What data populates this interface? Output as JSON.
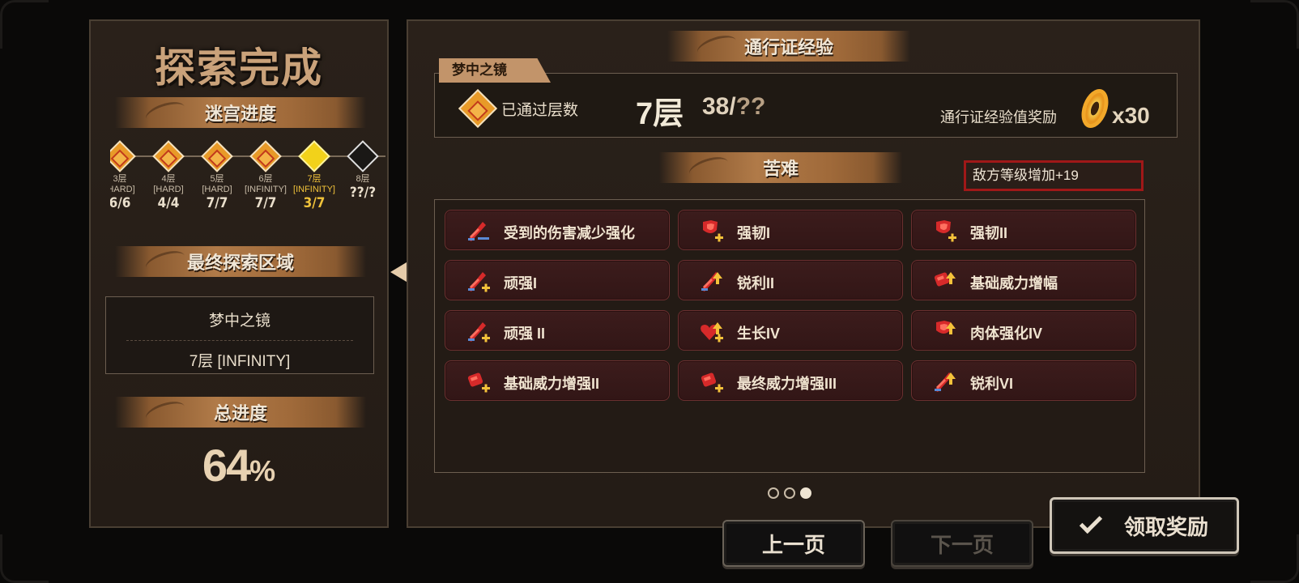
{
  "left": {
    "title": "探索完成",
    "maze_header": "迷宫进度",
    "floors": [
      {
        "name": "3层",
        "difficulty": "[HARD]",
        "progress": "6/6",
        "state": "done"
      },
      {
        "name": "4层",
        "difficulty": "[HARD]",
        "progress": "4/4",
        "state": "done"
      },
      {
        "name": "5层",
        "difficulty": "[HARD]",
        "progress": "7/7",
        "state": "done"
      },
      {
        "name": "6层",
        "difficulty": "[INFINITY]",
        "progress": "7/7",
        "state": "done"
      },
      {
        "name": "7层",
        "difficulty": "[INFINITY]",
        "progress": "3/7",
        "state": "current"
      },
      {
        "name": "8层",
        "difficulty": "",
        "progress": "??/?",
        "state": "locked"
      }
    ],
    "final_header": "最终探索区域",
    "final_area_name": "梦中之镜",
    "final_area_floor": "7层 [INFINITY]",
    "total_header": "总进度",
    "total_percent": "64",
    "total_percent_sign": "%"
  },
  "right": {
    "pass_header": "通行证经验",
    "tab_label": "梦中之镜",
    "passed_label": "已通过层数",
    "passed_floor": "7层",
    "passed_count": "38/",
    "passed_count_unknown": "??",
    "reward_label": "通行证经验值奖励",
    "reward_qty": "x30",
    "hardship_header": "苦难",
    "enemy_level_tag": "敌方等级增加+19",
    "buffs": [
      {
        "label": "受到的伤害减少强化",
        "icon": "sword-shield-icon"
      },
      {
        "label": "强韧I",
        "icon": "shield-heart-icon"
      },
      {
        "label": "强韧II",
        "icon": "shield-heart-icon"
      },
      {
        "label": "顽强I",
        "icon": "sword-plus-icon"
      },
      {
        "label": "锐利II",
        "icon": "sword-up-icon"
      },
      {
        "label": "基础威力增幅",
        "icon": "fist-up-icon"
      },
      {
        "label": "顽强 II",
        "icon": "sword-plus-icon"
      },
      {
        "label": "生长IV",
        "icon": "heart-plus-icon"
      },
      {
        "label": "肉体强化IV",
        "icon": "shield-up-icon"
      },
      {
        "label": "基础威力增强II",
        "icon": "fist-plus-icon"
      },
      {
        "label": "最终威力增强III",
        "icon": "fist-plus-icon"
      },
      {
        "label": "锐利VI",
        "icon": "sword-up-icon"
      }
    ],
    "page_dots": 3,
    "current_page": 3
  },
  "buttons": {
    "prev": "上一页",
    "next": "下一页",
    "claim": "领取奖励"
  },
  "colors": {
    "accent_gold": "#f0c23a",
    "banner_copper": "#b07a48",
    "buff_red": "#3c1c1c",
    "tag_border": "#a01818"
  }
}
